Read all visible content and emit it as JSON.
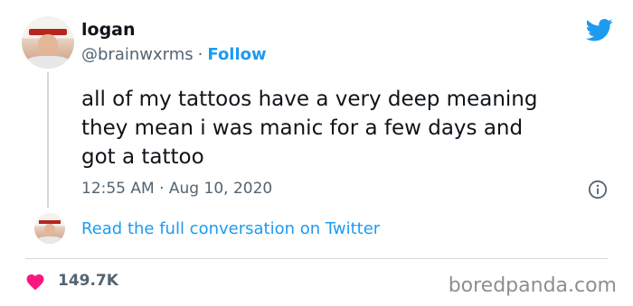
{
  "tweet": {
    "display_name": "logan",
    "handle": "@brainwxrms",
    "separator": "·",
    "follow_label": "Follow",
    "text": "all of my tattoos have a very deep meaning\nthey mean i was manic for a few days and\ngot a tattoo",
    "timestamp": "12:55 AM · Aug 10, 2020",
    "read_full_label": "Read the full conversation on Twitter",
    "likes": "149.7K"
  },
  "watermark": "boredpanda.com",
  "icons": {
    "bird": "twitter-bird-icon",
    "info": "info-icon",
    "heart": "heart-icon"
  },
  "colors": {
    "accent": "#1d9bf0",
    "heart": "#f91880",
    "muted": "#536471",
    "text": "#0f1419"
  }
}
